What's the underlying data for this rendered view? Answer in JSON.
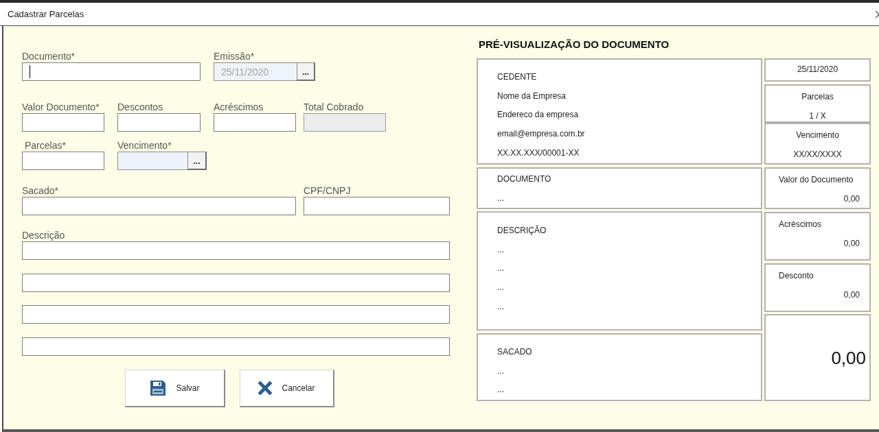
{
  "window": {
    "title": "Cadastrar Parcelas"
  },
  "form": {
    "rows": [
      {
        "fields": [
          {
            "label": "Documento*",
            "kind": "text",
            "disabled": false,
            "focused": true
          },
          {
            "label": "Emissão*",
            "kind": "date",
            "value": "25/11/2020",
            "button": "...",
            "disabled": true,
            "focused": false
          }
        ]
      },
      {
        "fields": [
          {
            "label": "Valor Documento*",
            "kind": "text",
            "disabled": false,
            "focused": false
          },
          {
            "label": "Descontos",
            "kind": "text",
            "disabled": false,
            "focused": false
          },
          {
            "label": "Acréscimos",
            "kind": "text",
            "disabled": false,
            "focused": false
          },
          {
            "label": "Total Cobrado",
            "kind": "text",
            "disabled": true,
            "focused": false
          }
        ]
      },
      {
        "fields": [
          {
            "label": "Parcelas*",
            "kind": "text",
            "disabled": false,
            "focused": false
          },
          {
            "label": "Vencimento*",
            "kind": "date",
            "button": "...",
            "disabled": true,
            "focused": false
          }
        ]
      },
      {
        "fields": [
          {
            "label": "Sacado*",
            "kind": "text",
            "disabled": false,
            "focused": false
          },
          {
            "label": "CPF/CNPJ",
            "kind": "text",
            "disabled": false,
            "focused": false
          }
        ]
      },
      {
        "fields": [
          {
            "label": "Descrição",
            "kind": "multiline",
            "lines": [
              {
                "kind": "text"
              },
              {
                "kind": "text"
              },
              {
                "kind": "text"
              },
              {
                "kind": "text"
              }
            ]
          }
        ]
      }
    ]
  },
  "buttons": [
    {
      "label": "Salvar",
      "kind": "save"
    },
    {
      "label": "Cancelar",
      "kind": "cancel"
    }
  ],
  "preview": {
    "title": "PRÉ-VISUALIZAÇÃO DO DOCUMENTO",
    "sections": [
      {
        "heading": "CEDENTE",
        "lines": [
          "Nome da Empresa",
          "Endereco da empresa",
          "email@empresa.com.br",
          "XX.XX.XXX/00001-XX"
        ]
      },
      {
        "heading": "DOCUMENTO",
        "lines": [
          "..."
        ]
      },
      {
        "heading": "DESCRIÇÃO",
        "lines": [
          "...",
          "...",
          "...",
          "..."
        ]
      },
      {
        "heading": "SACADO",
        "lines": [
          "...",
          "..."
        ]
      }
    ],
    "summary": [
      {
        "kind": "date",
        "value": "25/11/2020"
      },
      {
        "kind": "count",
        "label": "Parcelas",
        "value": "1 / X"
      },
      {
        "kind": "count",
        "label": "Vencimento",
        "value": "XX/XX/XXXX"
      },
      {
        "kind": "amount",
        "label": "Valor do Documento",
        "value": "0,00"
      },
      {
        "kind": "amount",
        "label": "Acréscimos",
        "value": "0,00"
      },
      {
        "kind": "amount",
        "label": "Desconto",
        "value": "0,00"
      },
      {
        "kind": "total",
        "value": "0,00"
      }
    ]
  }
}
